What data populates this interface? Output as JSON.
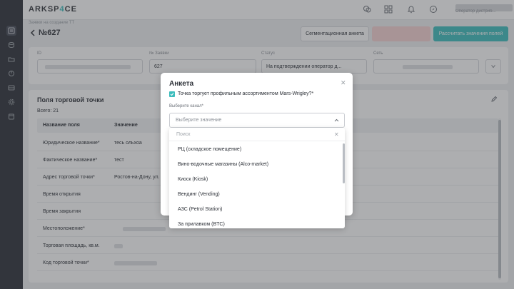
{
  "app": {
    "logo_main": "ARKSP",
    "logo_accent": "4",
    "logo_tail": "CE"
  },
  "topbar": {
    "user_role": "Оператор дистриб..."
  },
  "header": {
    "breadcrumb": "Заявки на создание ТТ",
    "title": "№627",
    "btn_segment": "Сегментационная анкета",
    "btn_calc": "Рассчитать значения полей"
  },
  "info": {
    "id_label": "ID",
    "request_label": "№ Заявки",
    "request_value": "627",
    "status_label": "Статус",
    "status_value": "На подтверждении оператор д...",
    "network_label": "Сеть"
  },
  "table": {
    "title": "Поля торговой точки",
    "total": "Всего: 21",
    "col_field": "Название поля",
    "col_value": "Значение",
    "rows": [
      {
        "name": "Юридическое название*",
        "value": "тесь ольхоа"
      },
      {
        "name": "Фактическое название*",
        "value": "тест"
      },
      {
        "name": "Адрес торговой точки*",
        "value": "Ростов-на-Дону, ул."
      },
      {
        "name": "Время открытия",
        "value": ""
      },
      {
        "name": "Время закрытия",
        "value": ""
      },
      {
        "name": "Местоположение*",
        "value": ""
      },
      {
        "name": "Торговая площадь, кв.м.",
        "value": ""
      },
      {
        "name": "Код торговой точки*",
        "value": ""
      }
    ]
  },
  "modal": {
    "title": "Анкета",
    "checkbox_label": "Точка торгует профильным ассортиментом Mars-Wrigley?*",
    "select_label": "Выберите канал*",
    "select_placeholder": "Выберите значение"
  },
  "dropdown": {
    "search_placeholder": "Поиск",
    "options": [
      "РЦ (складское помещение)",
      "Вино-водочные магазины (Alco-market)",
      "Киоск (Kiosk)",
      "Вендинг (Vending)",
      "АЗС (Petrol Station)",
      "За прилавком (BTC)"
    ]
  },
  "colors": {
    "accent": "#3dbdbd",
    "sidebar": "#2c3038",
    "muted_button": "#f6d3d3"
  }
}
